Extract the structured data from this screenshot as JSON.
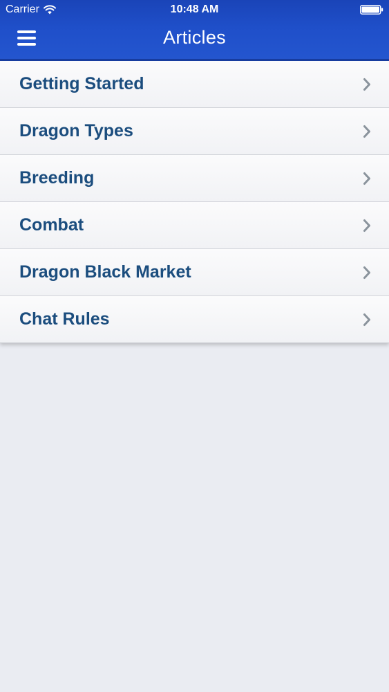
{
  "status_bar": {
    "carrier": "Carrier",
    "time": "10:48 AM",
    "icons": [
      "wifi-icon",
      "battery-icon"
    ]
  },
  "nav_bar": {
    "title": "Articles",
    "menu_icon": "hamburger-menu-icon"
  },
  "articles": {
    "items": [
      {
        "label": "Getting Started"
      },
      {
        "label": "Dragon Types"
      },
      {
        "label": "Breeding"
      },
      {
        "label": "Combat"
      },
      {
        "label": "Dragon Black Market"
      },
      {
        "label": "Chat Rules"
      }
    ],
    "row_icon": "chevron-right-icon"
  },
  "colors": {
    "header_blue": "#1f4fc9",
    "item_text": "#1b4d7e",
    "chevron": "#8a939c",
    "background": "#eaecf2"
  }
}
